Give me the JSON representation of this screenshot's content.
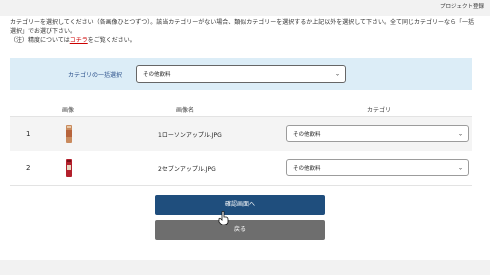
{
  "header": {
    "project_label": "プロジェクト登録"
  },
  "instructions": {
    "line1": "カテゴリーを選択してください（各画像ひとつずつ）。該当カテゴリーがない場合、類似カテゴリーを選択するか上記以外を選択して下さい。全て同じカテゴリーなら「一括選択」でお選び下さい。",
    "note_prefix": "（注）精度については",
    "note_link": "コチラ",
    "note_suffix": "をご覧ください。"
  },
  "bulk": {
    "label": "カテゴリの一括選択",
    "selected": "その他飲料"
  },
  "table": {
    "col_image": "画像",
    "col_name": "画像名",
    "col_category": "カテゴリ",
    "rows": [
      {
        "num": "1",
        "filename": "1ローソンアップル.JPG",
        "category": "その他飲料",
        "thumb_color": "#b7643c"
      },
      {
        "num": "2",
        "filename": "2セブンアップル.JPG",
        "category": "その他飲料",
        "thumb_color": "#b3202c"
      }
    ]
  },
  "buttons": {
    "confirm": "確認画面へ",
    "back": "戻る"
  }
}
